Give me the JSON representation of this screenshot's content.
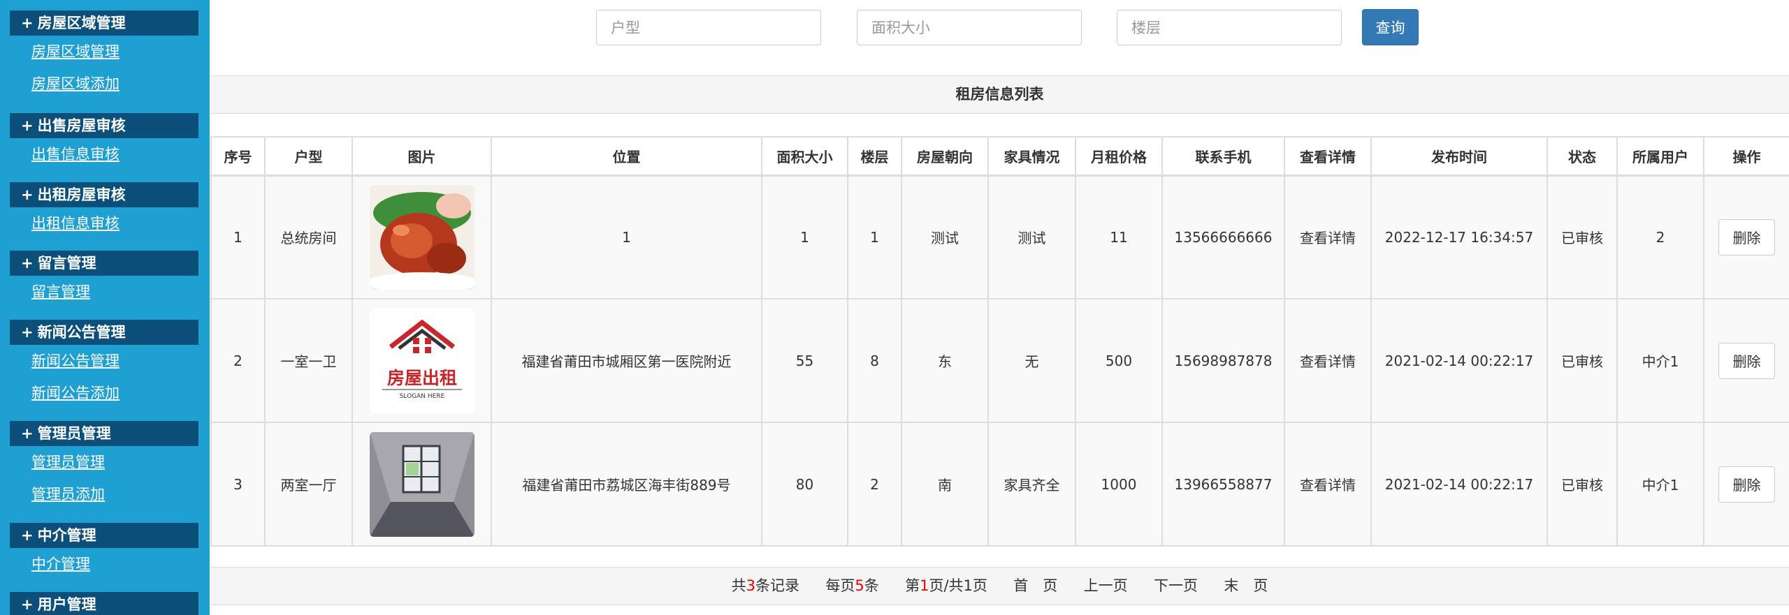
{
  "sidebar": {
    "groups": [
      {
        "header": "房屋区域管理",
        "items": [
          "房屋区域管理",
          "房屋区域添加"
        ]
      },
      {
        "header": "出售房屋审核",
        "items": [
          "出售信息审核"
        ]
      },
      {
        "header": "出租房屋审核",
        "items": [
          "出租信息审核"
        ]
      },
      {
        "header": "留言管理",
        "items": [
          "留言管理"
        ]
      },
      {
        "header": "新闻公告管理",
        "items": [
          "新闻公告管理",
          "新闻公告添加"
        ]
      },
      {
        "header": "管理员管理",
        "items": [
          "管理员管理",
          "管理员添加"
        ]
      },
      {
        "header": "中介管理",
        "items": [
          "中介管理"
        ]
      },
      {
        "header": "用户管理",
        "items": []
      }
    ],
    "plus": "+"
  },
  "search": {
    "huxing_placeholder": "户型",
    "area_placeholder": "面积大小",
    "floor_placeholder": "楼层",
    "button": "查询"
  },
  "title": "租房信息列表",
  "table": {
    "headers": [
      "序号",
      "户型",
      "图片",
      "位置",
      "面积大小",
      "楼层",
      "房屋朝向",
      "家具情况",
      "月租价格",
      "联系手机",
      "查看详情",
      "发布时间",
      "状态",
      "所属用户",
      "操作"
    ],
    "rows": [
      {
        "no": "1",
        "type": "总统房间",
        "location": "1",
        "area": "1",
        "floor": "1",
        "orientation": "测试",
        "furniture": "测试",
        "rent": "11",
        "phone": "13566666666",
        "detail": "查看详情",
        "time": "2022-12-17 16:34:57",
        "status": "已审核",
        "owner": "2",
        "action": "删除"
      },
      {
        "no": "2",
        "type": "一室一卫",
        "location": "福建省莆田市城厢区第一医院附近",
        "area": "55",
        "floor": "8",
        "orientation": "东",
        "furniture": "无",
        "rent": "500",
        "phone": "15698987878",
        "detail": "查看详情",
        "time": "2021-02-14 00:22:17",
        "status": "已审核",
        "owner": "中介1",
        "action": "删除",
        "image_text": "房屋出租",
        "image_slogan": "SLOGAN HERE"
      },
      {
        "no": "3",
        "type": "两室一厅",
        "location": "福建省莆田市荔城区海丰街889号",
        "area": "80",
        "floor": "2",
        "orientation": "南",
        "furniture": "家具齐全",
        "rent": "1000",
        "phone": "13966558877",
        "detail": "查看详情",
        "time": "2021-02-14 00:22:17",
        "status": "已审核",
        "owner": "中介1",
        "action": "删除"
      }
    ]
  },
  "pager": {
    "total_prefix": "共",
    "total": "3",
    "total_suffix": "条记录",
    "per_prefix": "每页",
    "per": "5",
    "per_suffix": "条",
    "page_prefix": "第",
    "page": "1",
    "page_suffix": "页/共1页",
    "first": "首　页",
    "prev": "上一页",
    "next": "下一页",
    "last": "末　页"
  },
  "colors": {
    "sidebar_bg": "#1ea0d3",
    "sidebar_header": "#0b4f7a",
    "primary_button": "#337ab7",
    "pager_highlight": "#ee0000"
  }
}
